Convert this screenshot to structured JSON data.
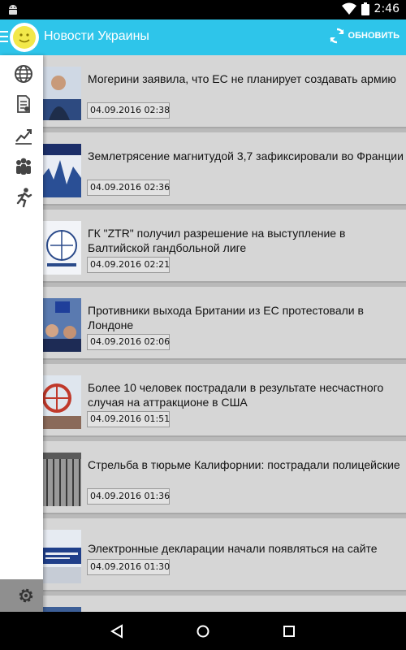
{
  "status_bar": {
    "time": "2:46"
  },
  "app_bar": {
    "title": "Новости Украины",
    "refresh_label": "ОБНОВИТЬ"
  },
  "drawer": {
    "items": [
      {
        "icon": "globe-icon"
      },
      {
        "icon": "document-icon"
      },
      {
        "icon": "chart-icon"
      },
      {
        "icon": "people-icon"
      },
      {
        "icon": "running-icon"
      }
    ],
    "settings_icon": "gear-icon"
  },
  "news": [
    {
      "headline": "Могерини заявила, что ЕС не планирует создавать армию",
      "date": "04.09.2016 02:38"
    },
    {
      "headline": "Землетрясение магнитудой 3,7 зафиксировали во Франции",
      "date": "04.09.2016 02:36"
    },
    {
      "headline": "ГК \"ZTR\" получил разрешение на выступление в Балтийской гандбольной лиге",
      "date": "04.09.2016 02:21"
    },
    {
      "headline": "Противники выхода Британии из ЕС протестовали в Лондоне",
      "date": "04.09.2016 02:06"
    },
    {
      "headline": "Более 10 человек пострадали в результате несчастного случая на аттракционе в США",
      "date": "04.09.2016 01:51"
    },
    {
      "headline": "Стрельба в тюрьме Калифорнии: пострадали полицейские",
      "date": "04.09.2016 01:36"
    },
    {
      "headline": "Электронные декларации начали появляться на сайте",
      "date": "04.09.2016 01:30"
    }
  ]
}
